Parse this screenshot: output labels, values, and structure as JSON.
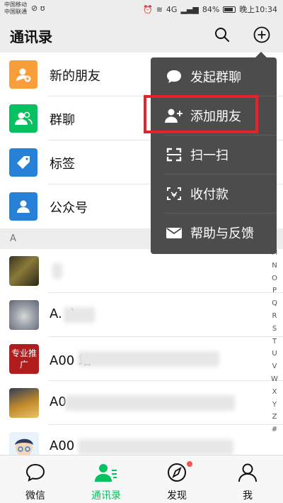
{
  "status_bar": {
    "carrier_line1": "中国移动",
    "carrier_line2": "中国联通",
    "network": "4G",
    "battery": "84%",
    "time": "晚上10:34"
  },
  "header": {
    "title": "通讯录"
  },
  "list_items": [
    {
      "label": "新的朋友",
      "icon": "add-person-icon",
      "color": "#fa9d3b"
    },
    {
      "label": "群聊",
      "icon": "group-icon",
      "color": "#07c160"
    },
    {
      "label": "标签",
      "icon": "tag-icon",
      "color": "#2782d7"
    },
    {
      "label": "公众号",
      "icon": "official-account-icon",
      "color": "#2782d7"
    }
  ],
  "section": {
    "letter": "A"
  },
  "contacts": [
    {
      "name": "",
      "avatar": "photo-dark"
    },
    {
      "name": "A.        :)",
      "avatar": "photo-cat"
    },
    {
      "name": "A00          站",
      "avatar_text": "专业推广",
      "avatar": "badge-red"
    },
    {
      "name": "A0",
      "avatar": "photo-desk"
    },
    {
      "name": "A00",
      "avatar": "cartoon"
    }
  ],
  "index_letters": [
    "M",
    "N",
    "O",
    "P",
    "Q",
    "R",
    "S",
    "T",
    "U",
    "V",
    "W",
    "X",
    "Y",
    "Z",
    "#"
  ],
  "menu": {
    "items": [
      {
        "label": "发起群聊",
        "icon": "chat-bubble-icon"
      },
      {
        "label": "添加朋友",
        "icon": "add-friend-icon"
      },
      {
        "label": "扫一扫",
        "icon": "scan-icon"
      },
      {
        "label": "收付款",
        "icon": "payment-icon"
      },
      {
        "label": "帮助与反馈",
        "icon": "mail-icon"
      }
    ],
    "highlighted_index": 1,
    "highlight_color": "#e8222a"
  },
  "tabs": [
    {
      "label": "微信",
      "icon": "chat-icon"
    },
    {
      "label": "通讯录",
      "icon": "contacts-icon",
      "active": true
    },
    {
      "label": "发现",
      "icon": "compass-icon"
    },
    {
      "label": "我",
      "icon": "me-icon"
    }
  ],
  "accent_color": "#07c160"
}
